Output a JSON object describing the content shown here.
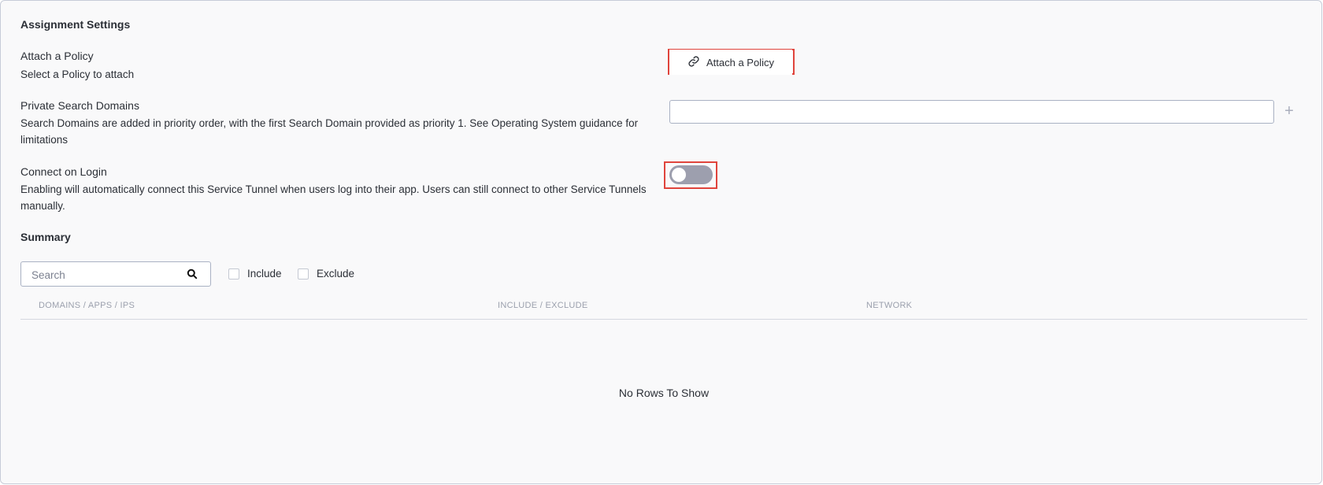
{
  "section": {
    "title": "Assignment Settings"
  },
  "policy": {
    "title": "Attach a Policy",
    "description": "Select a Policy to attach",
    "button_label": "Attach a Policy",
    "button_icon": "link-icon"
  },
  "search_domains": {
    "title": "Private Search Domains",
    "description": "Search Domains are added in priority order, with the first Search Domain provided as priority 1. See Operating System guidance for limitations",
    "value": "",
    "add_icon": "plus-icon"
  },
  "connect_on_login": {
    "title": "Connect on Login",
    "description": "Enabling will automatically connect this Service Tunnel when users log into their app. Users can still connect to other Service Tunnels manually.",
    "enabled": false
  },
  "summary": {
    "title": "Summary",
    "search_placeholder": "Search",
    "filters": [
      {
        "label": "Include",
        "checked": false
      },
      {
        "label": "Exclude",
        "checked": false
      }
    ],
    "columns": [
      "DOMAINS / APPS / IPS",
      "INCLUDE / EXCLUDE",
      "NETWORK"
    ],
    "empty_message": "No Rows To Show"
  },
  "colors": {
    "highlight": "#e0443c",
    "toggle_off": "#9d9fae",
    "panel_bg": "#f9f9fa"
  }
}
